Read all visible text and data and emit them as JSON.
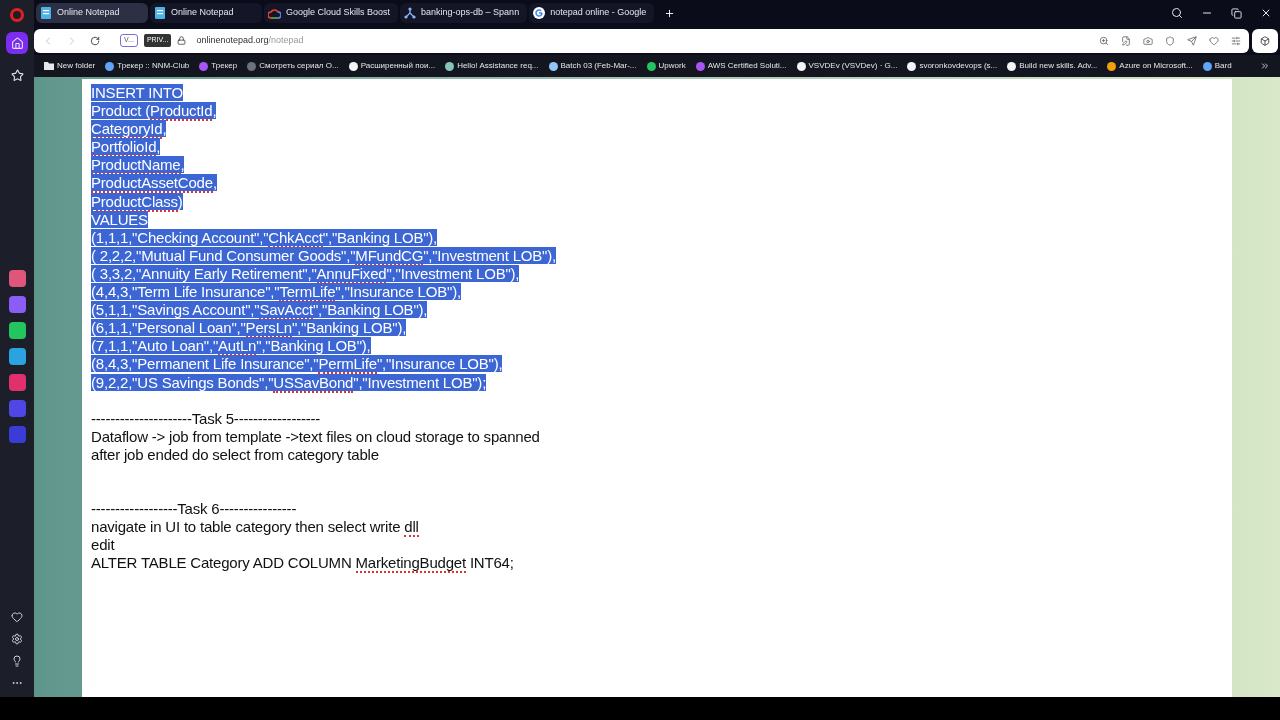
{
  "tabs": [
    {
      "title": "Online Notepad",
      "selected": true
    },
    {
      "title": "Online Notepad",
      "selected": false
    },
    {
      "title": "Google Cloud Skills Boost",
      "selected": false
    },
    {
      "title": "banking-ops-db – Spann",
      "selected": false
    },
    {
      "title": "notepad online - Google",
      "selected": false
    }
  ],
  "address_bar": {
    "vpn_badge": "V...",
    "private_badge": "PRIV...",
    "host": "onlinenotepad.org",
    "path": "/notepad"
  },
  "bookmarks": [
    {
      "label": "New folder",
      "color": "#e5e7eb"
    },
    {
      "label": "Трекер :: NNM-Club",
      "color": "#60a5fa"
    },
    {
      "label": "Трекер",
      "color": "#a855f7"
    },
    {
      "label": "Смотреть сериал О...",
      "color": "#6b7280"
    },
    {
      "label": "Расширенный пои...",
      "color": "#f3f4f6"
    },
    {
      "label": "Hello! Assistance req...",
      "color": "#86c5b8"
    },
    {
      "label": "Batch 03 (Feb-Mar-...",
      "color": "#93c5fd"
    },
    {
      "label": "Upwork",
      "color": "#22c55e"
    },
    {
      "label": "AWS Certified Soluti...",
      "color": "#a855f7"
    },
    {
      "label": "VSVDEv (VSVDev) · G...",
      "color": "#f3f4f6"
    },
    {
      "label": "svoronkovdevops (s...",
      "color": "#f3f4f6"
    },
    {
      "label": "Build new skills. Adv...",
      "color": "#f3f4f6"
    },
    {
      "label": "Azure on Microsoft...",
      "color": "#f59e0b"
    },
    {
      "label": "Bard",
      "color": "#60a5fa"
    }
  ],
  "sidebar": {
    "items": [
      {
        "selected": true
      },
      {
        "selected": false
      }
    ],
    "apps": [
      {
        "color": "#e0567a"
      },
      {
        "color": "#8b5cf6"
      },
      {
        "color": "#22c55e"
      },
      {
        "color": "#2aa3e0"
      },
      {
        "color": "#e1306c"
      },
      {
        "color": "#4f46e5"
      },
      {
        "color": "#3b3bd8"
      }
    ]
  },
  "document": {
    "blocks": [
      {
        "selected": true,
        "lines": [
          [
            {
              "text": "INSERT INTO",
              "misspelled": false
            }
          ],
          [
            {
              "text": "Product (",
              "misspelled": false
            },
            {
              "text": "ProductId",
              "misspelled": true
            },
            {
              "text": ",",
              "misspelled": false
            }
          ],
          [
            {
              "text": "CategoryId",
              "misspelled": true
            },
            {
              "text": ",",
              "misspelled": false
            }
          ],
          [
            {
              "text": "PortfolioId",
              "misspelled": true
            },
            {
              "text": ",",
              "misspelled": false
            }
          ],
          [
            {
              "text": "ProductName",
              "misspelled": true
            },
            {
              "text": ",",
              "misspelled": false
            }
          ],
          [
            {
              "text": "ProductAssetCode",
              "misspelled": true
            },
            {
              "text": ",",
              "misspelled": false
            }
          ],
          [
            {
              "text": "ProductClass",
              "misspelled": true
            },
            {
              "text": ")",
              "misspelled": false
            }
          ],
          [
            {
              "text": "VALUES",
              "misspelled": false
            }
          ],
          [
            {
              "text": "(1,1,1,\"Checking Account\",\"",
              "misspelled": false
            },
            {
              "text": "ChkAcct",
              "misspelled": true
            },
            {
              "text": "\",\"Banking LOB\"),",
              "misspelled": false
            }
          ],
          [
            {
              "text": "( 2,2,2,\"Mutual Fund Consumer Goods\",\"",
              "misspelled": false
            },
            {
              "text": "MFundCG",
              "misspelled": true
            },
            {
              "text": "\",\"Investment LOB\"),",
              "misspelled": false
            }
          ],
          [
            {
              "text": "( 3,3,2,\"Annuity Early Retirement\",\"",
              "misspelled": false
            },
            {
              "text": "AnnuFixed",
              "misspelled": true
            },
            {
              "text": "\",\"Investment LOB\"),",
              "misspelled": false
            }
          ],
          [
            {
              "text": "(4,4,3,\"Term Life Insurance\",\"",
              "misspelled": false
            },
            {
              "text": "TermLife",
              "misspelled": true
            },
            {
              "text": "\",\"Insurance LOB\"),",
              "misspelled": false
            }
          ],
          [
            {
              "text": "(5,1,1,\"Savings Account\",\"",
              "misspelled": false
            },
            {
              "text": "SavAcct",
              "misspelled": true
            },
            {
              "text": "\",\"Banking LOB\"),",
              "misspelled": false
            }
          ],
          [
            {
              "text": "(6,1,1,\"Personal Loan\",\"",
              "misspelled": false
            },
            {
              "text": "PersLn",
              "misspelled": true
            },
            {
              "text": "\",\"Banking LOB\"),",
              "misspelled": false
            }
          ],
          [
            {
              "text": "(7,1,1,\"Auto Loan\",\"",
              "misspelled": false
            },
            {
              "text": "AutLn",
              "misspelled": true
            },
            {
              "text": "\",\"Banking LOB\"),",
              "misspelled": false
            }
          ],
          [
            {
              "text": "(8,4,3,\"Permanent Life Insurance\",\"",
              "misspelled": false
            },
            {
              "text": "PermLife",
              "misspelled": true
            },
            {
              "text": "\",\"Insurance LOB\"),",
              "misspelled": false
            }
          ],
          [
            {
              "text": "(9,2,2,\"US Savings Bonds\",\"",
              "misspelled": false
            },
            {
              "text": "USSavBond",
              "misspelled": true
            },
            {
              "text": "\",\"Investment LOB\");",
              "misspelled": false
            }
          ]
        ]
      },
      {
        "selected": false,
        "lines": [
          [
            {
              "text": "---------------------Task 5------------------",
              "misspelled": false
            }
          ],
          [
            {
              "text": "Dataflow -> job from template ->text files on cloud storage to spanned",
              "misspelled": false
            }
          ],
          [
            {
              "text": "after job ended do select from category table",
              "misspelled": false
            }
          ]
        ]
      },
      {
        "selected": false,
        "lines": [
          [
            {
              "text": "------------------Task 6----------------",
              "misspelled": false
            }
          ],
          [
            {
              "text": "navigate in UI to table category then select write ",
              "misspelled": false
            },
            {
              "text": "dll",
              "misspelled": true
            }
          ],
          [
            {
              "text": "edit",
              "misspelled": false
            }
          ],
          [
            {
              "text": "ALTER TABLE Category ADD COLUMN ",
              "misspelled": false
            },
            {
              "text": "MarketingBudget",
              "misspelled": true
            },
            {
              "text": " INT64;",
              "misspelled": false
            }
          ]
        ]
      }
    ]
  }
}
